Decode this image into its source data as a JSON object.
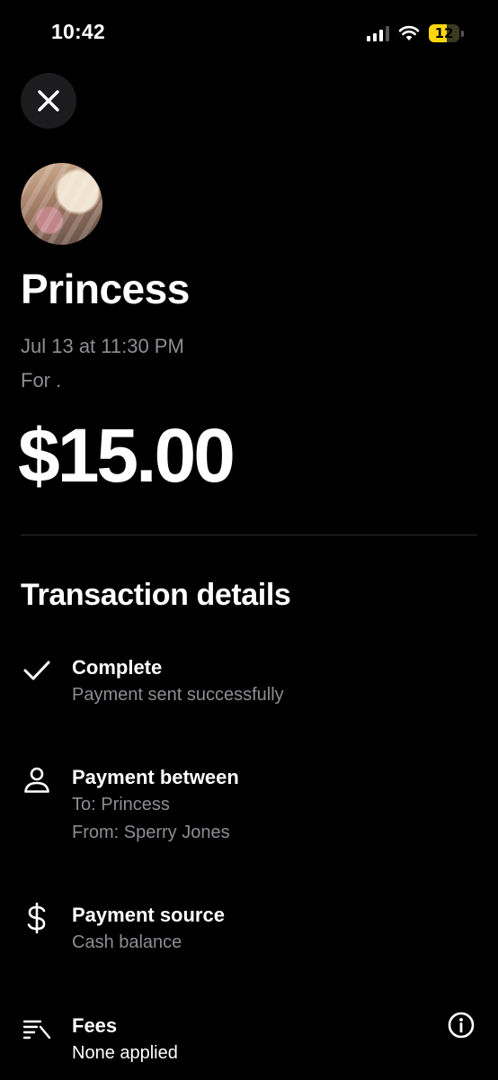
{
  "status_bar": {
    "time": "10:42",
    "battery_level": "12",
    "battery_fraction": 0.12,
    "battery_color": "#ffd60a",
    "signal_icon": "cellular-signal-icon",
    "wifi_icon": "wifi-icon"
  },
  "header": {
    "close_icon": "close-icon"
  },
  "recipient": {
    "name": "Princess",
    "date": "Jul 13 at 11:30 PM",
    "note": "For ."
  },
  "amount": "$15.00",
  "details": {
    "title": "Transaction details",
    "status": {
      "icon": "checkmark-icon",
      "title": "Complete",
      "subtitle": "Payment sent successfully"
    },
    "between": {
      "icon": "person-icon",
      "title": "Payment between",
      "to": "To: Princess",
      "from": "From: Sperry Jones"
    },
    "source": {
      "icon": "dollar-icon",
      "title": "Payment source",
      "subtitle": "Cash balance"
    },
    "fees": {
      "icon": "fees-list-icon",
      "title": "Fees",
      "subtitle": "None applied",
      "info_icon": "info-icon"
    }
  }
}
